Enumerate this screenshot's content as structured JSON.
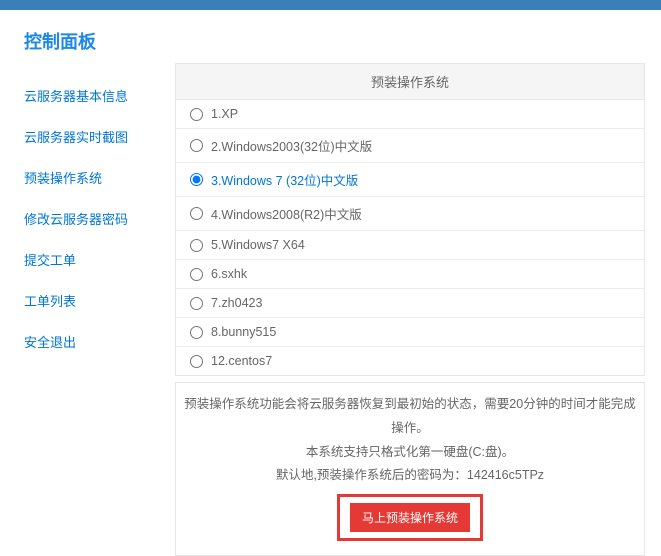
{
  "sidebar": {
    "title": "控制面板",
    "items": [
      {
        "label": "云服务器基本信息"
      },
      {
        "label": "云服务器实时截图"
      },
      {
        "label": "预装操作系统"
      },
      {
        "label": "修改云服务器密码"
      },
      {
        "label": "提交工单"
      },
      {
        "label": "工单列表"
      },
      {
        "label": "安全退出"
      }
    ]
  },
  "panel": {
    "header": "预装操作系统",
    "options": [
      {
        "label": "1.XP",
        "selected": false
      },
      {
        "label": "2.Windows2003(32位)中文版",
        "selected": false
      },
      {
        "label": "3.Windows 7 (32位)中文版",
        "selected": true
      },
      {
        "label": "4.Windows2008(R2)中文版",
        "selected": false
      },
      {
        "label": "5.Windows7 X64",
        "selected": false
      },
      {
        "label": "6.sxhk",
        "selected": false
      },
      {
        "label": "7.zh0423",
        "selected": false
      },
      {
        "label": "8.bunny515",
        "selected": false
      },
      {
        "label": "12.centos7",
        "selected": false
      }
    ]
  },
  "info": {
    "line1": "预装操作系统功能会将云服务器恢复到最初始的状态，需要20分钟的时间才能完成操作。",
    "line2": "本系统支持只格式化第一硬盘(C:盘)。",
    "line3": "默认地,预装操作系统后的密码为：142416c5TPz",
    "button": "马上预装操作系统"
  }
}
